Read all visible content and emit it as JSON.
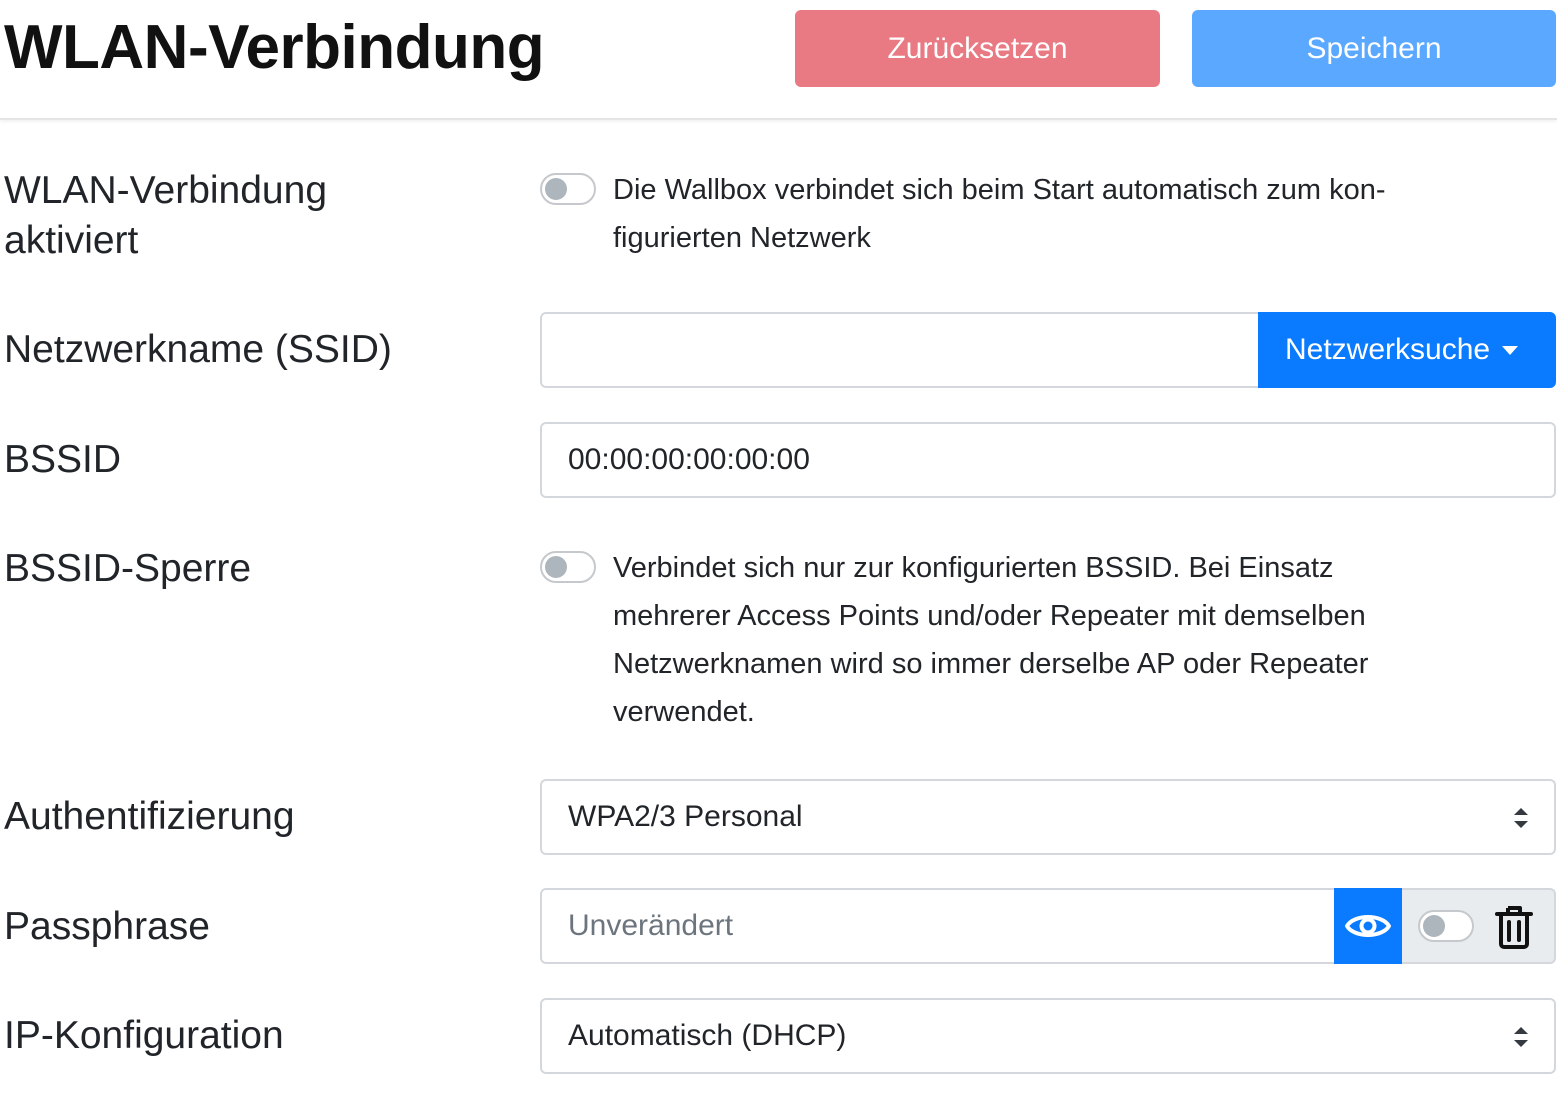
{
  "header": {
    "title": "WLAN-Verbindung",
    "reset_label": "Zurücksetzen",
    "save_label": "Speichern"
  },
  "form": {
    "wifi_enabled": {
      "label_line1": "WLAN-Verbindung",
      "label_line2": "aktiviert",
      "checked": false,
      "description": "Die Wallbox verbindet sich beim Start automatisch zum kon-figurierten Netzwerk",
      "description_line1": "Die Wallbox verbindet sich beim Start automatisch zum kon-",
      "description_line2": "figurierten Netzwerk"
    },
    "ssid": {
      "label": "Netzwerkname (SSID)",
      "value": "",
      "search_button": "Netzwerksuche"
    },
    "bssid": {
      "label": "BSSID",
      "value": "00:00:00:00:00:00"
    },
    "bssid_lock": {
      "label": "BSSID-Sperre",
      "checked": false,
      "description_line1": "Verbindet sich nur zur konfigurierten BSSID. Bei Einsatz",
      "description_line2": "mehrerer Access Points und/oder Repeater mit demselben",
      "description_line3": "Netzwerknamen wird so immer derselbe AP oder Repeater",
      "description_line4": "verwendet."
    },
    "authentication": {
      "label": "Authentifizierung",
      "selected": "WPA2/3 Personal"
    },
    "passphrase": {
      "label": "Passphrase",
      "placeholder": "Unverändert",
      "clear_toggle_checked": false
    },
    "ip_config": {
      "label": "IP-Konfiguration",
      "selected": "Automatisch (DHCP)"
    }
  },
  "icons": {
    "show_password": "eye-icon",
    "clear_passphrase": "trash-icon",
    "dropdown": "caret-down-icon",
    "select": "select-arrows-icon"
  },
  "colors": {
    "primary": "#0a7bff",
    "reset_button": "#e97982",
    "save_button": "#5aa8ff"
  }
}
